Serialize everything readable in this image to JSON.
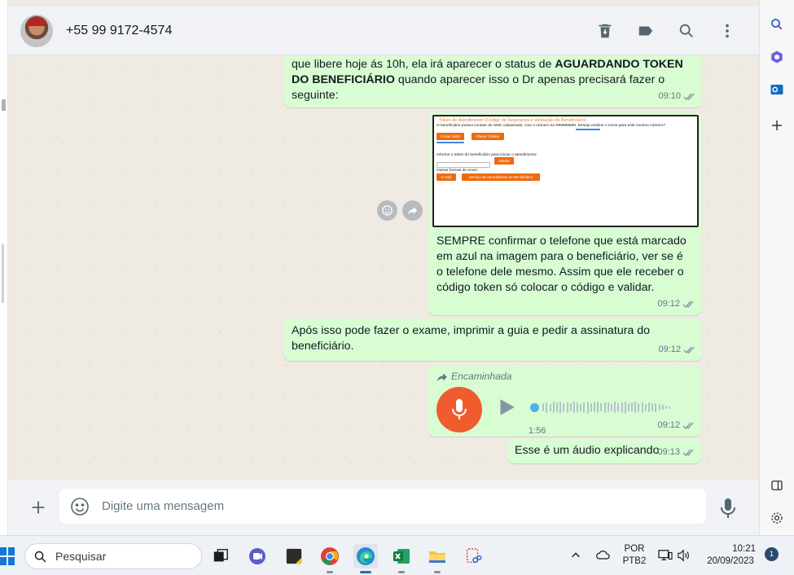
{
  "header": {
    "contact_name": "+55 99 9172-4574"
  },
  "messages": [
    {
      "id": "msg-1",
      "text_before": "que libere hoje ás 10h, ela irá aparecer o status de ",
      "text_bold_1": "AGUARDANDO TOKEN DO BENEFICIÁRIO",
      "text_after": " quando aparecer isso o Dr apenas precisará fazer o seguinte:",
      "time": "09:10"
    },
    {
      "id": "msg-2",
      "image": {
        "title": "Token de Atendimento (Código de Segurança e Validação do Beneficiário)",
        "line1": "O beneficiário possui contato de SMS cadastrado, com o número 61-999999999. Deseja realizar o envio para este mesmo número?",
        "btn_send": "Enviar SMS",
        "btn_change": "Alterar Celular",
        "line2": "Informe o token do beneficiário para iniciar o atendimento:",
        "btn_validate": "Validar",
        "line3": "Outras formas de envio:",
        "btn_email": "E-mail",
        "btn_service": "Serviço de Atendimento ao Beneficiário"
      },
      "text": "SEMPRE confirmar o telefone que está marcado em azul na imagem para o beneficiário, ver se é o telefone dele mesmo. Assim que ele receber o código token só colocar o código e validar.",
      "time": "09:12"
    },
    {
      "id": "msg-3",
      "text": "Após isso pode fazer o exame, imprimir a guia e pedir a assinatura do beneficiário.",
      "time": "09:12"
    },
    {
      "id": "msg-4",
      "forwarded_label": "Encaminhada",
      "duration": "1:56",
      "time": "09:12"
    },
    {
      "id": "msg-5",
      "text": "Esse é um áudio explicando",
      "time": "09:13"
    }
  ],
  "composer": {
    "placeholder": "Digite uma mensagem"
  },
  "taskbar": {
    "search_placeholder": "Pesquisar",
    "lang_top": "POR",
    "lang_bottom": "PTB2",
    "time": "10:21",
    "date": "20/09/2023",
    "notification_count": "1"
  },
  "colors": {
    "outgoing_bubble": "#d9fdd3",
    "chat_bg": "#efeae2",
    "voice_mic": "#f15c2e",
    "accent_blue": "#4fb0e8"
  }
}
